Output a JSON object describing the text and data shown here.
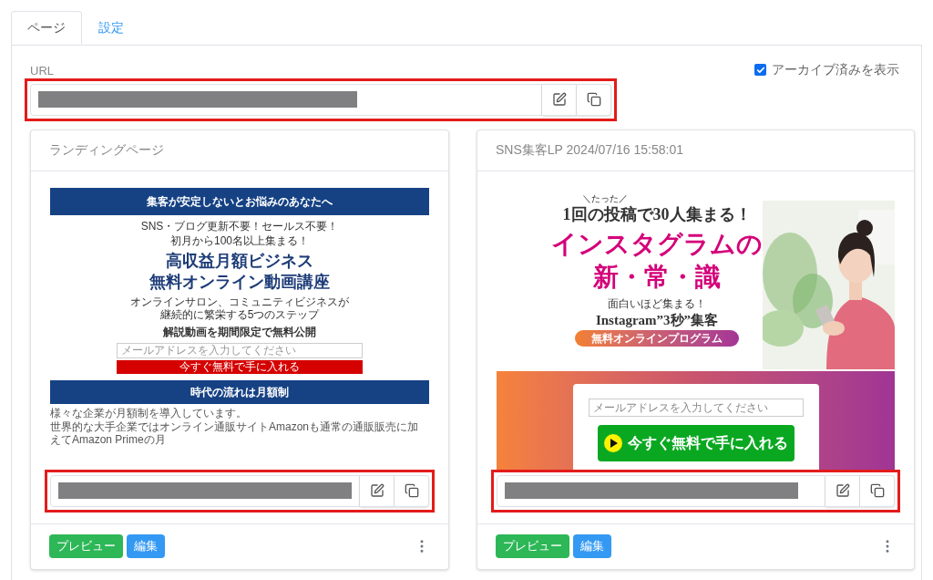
{
  "tabs": [
    {
      "label": "ページ",
      "selected": true
    },
    {
      "label": "設定",
      "selected": false
    }
  ],
  "url_section": {
    "label": "URL",
    "show_archived": {
      "label": "アーカイブ済みを表示",
      "checked": true
    },
    "field": {
      "highlighted": true
    }
  },
  "cards": [
    {
      "title": "ランディングページ",
      "preview": {
        "kind": "classic",
        "header": "集客が安定しないとお悩みのあなたへ",
        "lead": [
          "SNS・ブログ更新不要！セールス不要！",
          "初月から100名以上集まる！"
        ],
        "title": [
          "高収益月額ビジネス",
          "無料オンライン動画講座"
        ],
        "sub": [
          "オンラインサロン、コミュニティビジネスが",
          "継続的に繁栄する5つのステップ"
        ],
        "cta": "解説動画を期間限定で無料公開",
        "email_placeholder": "メールアドレスを入力してください",
        "button": "今すぐ無料で手に入れる",
        "section": "時代の流れは月額制",
        "paragraphs": [
          "様々な企業が月額制を導入しています。",
          "世界的な大手企業ではオンライン通販サイトAmazonも通常の通販販売に加えてAmazon Primeの月"
        ]
      },
      "field": {
        "highlighted": true
      },
      "actions": [
        "プレビュー",
        "編集"
      ]
    },
    {
      "title": "SNS集客LP 2024/07/16 15:58:01",
      "preview": {
        "kind": "banner",
        "kicker": "＼たった／",
        "lead": "**1**回の投稿で**30**人集まる！",
        "title": [
          "インスタグラムの",
          "新・常・識"
        ],
        "sub": "面白いほど集まる！",
        "tagline": "Instagram”3秒”集客",
        "pill": "無料オンラインプログラム",
        "email_placeholder": "メールアドレスを入力してください",
        "button": "今すぐ**無料**で手に入れる"
      },
      "field": {
        "highlighted": true
      },
      "actions": [
        "プレビュー",
        "編集"
      ]
    }
  ]
}
